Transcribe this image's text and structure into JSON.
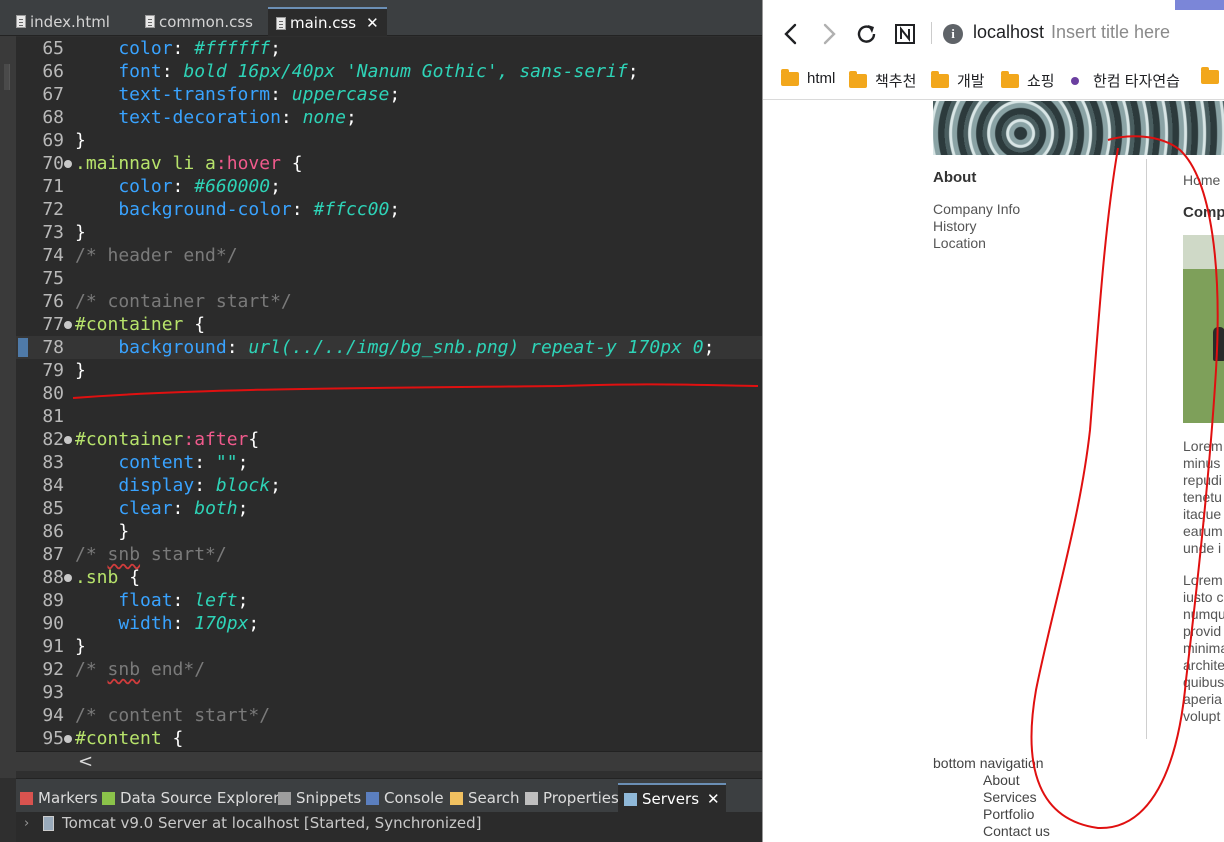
{
  "ide": {
    "tabs": [
      {
        "label": "index.html",
        "active": false
      },
      {
        "label": "common.css",
        "active": false
      },
      {
        "label": "main.css",
        "active": true,
        "close": "✕"
      }
    ],
    "code_lines": [
      {
        "num": "65",
        "parts": [
          [
            "prop",
            "    color"
          ],
          [
            "punc",
            ": "
          ],
          [
            "val",
            "#ffffff"
          ],
          [
            "punc",
            ";"
          ]
        ]
      },
      {
        "num": "66",
        "parts": [
          [
            "prop",
            "    font"
          ],
          [
            "punc",
            ": "
          ],
          [
            "val",
            "bold 16px/40px 'Nanum Gothic', sans-serif"
          ],
          [
            "punc",
            ";"
          ]
        ]
      },
      {
        "num": "67",
        "parts": [
          [
            "prop",
            "    text-transform"
          ],
          [
            "punc",
            ": "
          ],
          [
            "val",
            "uppercase"
          ],
          [
            "punc",
            ";"
          ]
        ]
      },
      {
        "num": "68",
        "parts": [
          [
            "prop",
            "    text-decoration"
          ],
          [
            "punc",
            ": "
          ],
          [
            "val",
            "none"
          ],
          [
            "punc",
            ";"
          ]
        ]
      },
      {
        "num": "69",
        "parts": [
          [
            "punc",
            "}"
          ]
        ]
      },
      {
        "num": "70",
        "fold": true,
        "parts": [
          [
            "sel",
            ".mainnav li a"
          ],
          [
            "pseudo",
            ":hover"
          ],
          [
            "punc",
            " {"
          ]
        ]
      },
      {
        "num": "71",
        "parts": [
          [
            "prop",
            "    color"
          ],
          [
            "punc",
            ": "
          ],
          [
            "val",
            "#660000"
          ],
          [
            "punc",
            ";"
          ]
        ]
      },
      {
        "num": "72",
        "parts": [
          [
            "prop",
            "    background-color"
          ],
          [
            "punc",
            ": "
          ],
          [
            "val",
            "#ffcc00"
          ],
          [
            "punc",
            ";"
          ]
        ]
      },
      {
        "num": "73",
        "parts": [
          [
            "punc",
            "}"
          ]
        ]
      },
      {
        "num": "74",
        "parts": [
          [
            "cmt",
            "/* header end*/"
          ]
        ]
      },
      {
        "num": "75",
        "parts": []
      },
      {
        "num": "76",
        "parts": [
          [
            "cmt",
            "/* container start*/"
          ]
        ]
      },
      {
        "num": "77",
        "fold": true,
        "parts": [
          [
            "sel",
            "#container"
          ],
          [
            "punc",
            " {"
          ]
        ]
      },
      {
        "num": "78",
        "highlight": true,
        "parts": [
          [
            "prop",
            "    background"
          ],
          [
            "punc",
            ": "
          ],
          [
            "val",
            "url(../../img/bg_snb.png) repeat-y 170px 0"
          ],
          [
            "punc",
            ";"
          ]
        ]
      },
      {
        "num": "79",
        "parts": [
          [
            "punc",
            "}"
          ]
        ]
      },
      {
        "num": "80",
        "parts": []
      },
      {
        "num": "81",
        "parts": []
      },
      {
        "num": "82",
        "fold": true,
        "parts": [
          [
            "sel",
            "#container"
          ],
          [
            "pseudo",
            ":after"
          ],
          [
            "punc",
            "{"
          ]
        ]
      },
      {
        "num": "83",
        "parts": [
          [
            "prop",
            "    content"
          ],
          [
            "punc",
            ": "
          ],
          [
            "val",
            "\"\""
          ],
          [
            "punc",
            ";"
          ]
        ]
      },
      {
        "num": "84",
        "parts": [
          [
            "prop",
            "    display"
          ],
          [
            "punc",
            ": "
          ],
          [
            "val",
            "block"
          ],
          [
            "punc",
            ";"
          ]
        ]
      },
      {
        "num": "85",
        "parts": [
          [
            "prop",
            "    clear"
          ],
          [
            "punc",
            ": "
          ],
          [
            "val",
            "both"
          ],
          [
            "punc",
            ";"
          ]
        ]
      },
      {
        "num": "86",
        "parts": [
          [
            "punc",
            "    }"
          ]
        ]
      },
      {
        "num": "87",
        "parts": [
          [
            "cmt",
            "/* "
          ],
          [
            "cmtsq",
            "snb"
          ],
          [
            "cmt",
            " start*/"
          ]
        ]
      },
      {
        "num": "88",
        "fold": true,
        "parts": [
          [
            "sel",
            ".snb"
          ],
          [
            "punc",
            " {"
          ]
        ]
      },
      {
        "num": "89",
        "parts": [
          [
            "prop",
            "    float"
          ],
          [
            "punc",
            ": "
          ],
          [
            "val",
            "left"
          ],
          [
            "punc",
            ";"
          ]
        ]
      },
      {
        "num": "90",
        "parts": [
          [
            "prop",
            "    width"
          ],
          [
            "punc",
            ": "
          ],
          [
            "val",
            "170px"
          ],
          [
            "punc",
            ";"
          ]
        ]
      },
      {
        "num": "91",
        "parts": [
          [
            "punc",
            "}"
          ]
        ]
      },
      {
        "num": "92",
        "parts": [
          [
            "cmt",
            "/* "
          ],
          [
            "cmtsq",
            "snb"
          ],
          [
            "cmt",
            " end*/"
          ]
        ]
      },
      {
        "num": "93",
        "parts": []
      },
      {
        "num": "94",
        "parts": [
          [
            "cmt",
            "/* content start*/"
          ]
        ]
      },
      {
        "num": "95",
        "fold": true,
        "parts": [
          [
            "sel",
            "#content"
          ],
          [
            "punc",
            " {"
          ]
        ]
      }
    ],
    "hscroll_arrow": "<",
    "views": [
      {
        "label": "Markers",
        "icon": "markers-icon",
        "color": "#d9534f"
      },
      {
        "label": "Data Source Explorer",
        "icon": "data-source-icon",
        "color": "#8bc34a"
      },
      {
        "label": "Snippets",
        "icon": "snippets-icon",
        "color": "#9e9e9e"
      },
      {
        "label": "Console",
        "icon": "console-icon",
        "color": "#5b7fbf"
      },
      {
        "label": "Search",
        "icon": "search-icon",
        "color": "#f0c060"
      },
      {
        "label": "Properties",
        "icon": "properties-icon",
        "color": "#bfbfbf"
      },
      {
        "label": "Servers",
        "icon": "servers-icon",
        "color": "#8fb8d8",
        "active": true,
        "close": "✕"
      }
    ],
    "server_entry": "Tomcat v9.0 Server at localhost  [Started, Synchronized]",
    "server_chevron": "›"
  },
  "browser": {
    "host": "localhost",
    "page_title": "Insert title here",
    "info_glyph": "i",
    "bookmarks": [
      {
        "label": "html",
        "type": "folder"
      },
      {
        "label": "책추천",
        "type": "folder"
      },
      {
        "label": "개발",
        "type": "folder"
      },
      {
        "label": "쇼핑",
        "type": "folder"
      },
      {
        "label": "한컴 타자연습",
        "type": "dot"
      },
      {
        "label": "",
        "type": "folder"
      }
    ],
    "page": {
      "snb_title": "About",
      "snb_items": [
        "Company Info",
        "History",
        "Location"
      ],
      "breadcrumb": "Home",
      "content_title": "Comp",
      "para1": [
        "Lorem",
        "minus",
        "repudi",
        "tenetu",
        "itaque",
        "earum",
        "unde i"
      ],
      "para2": [
        "Lorem",
        "iusto c",
        "numqu",
        "provid",
        "minima",
        "archite",
        "quibus",
        "aperia",
        "volupt"
      ],
      "bottom_nav_title": "bottom navigation",
      "bottom_nav_items": [
        "About",
        "Services",
        "Portfolio",
        "Contact us"
      ]
    }
  },
  "colors": {
    "annotation": "#e01010",
    "accent_tab": "#6b8fb5"
  }
}
